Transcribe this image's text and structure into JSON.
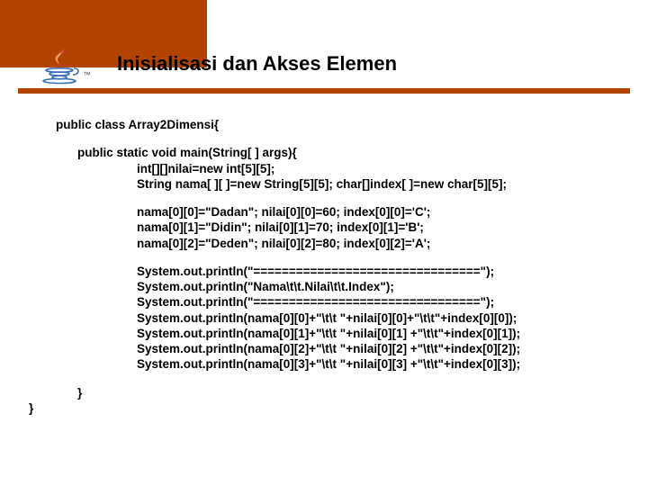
{
  "header": {
    "title": "Inisialisasi dan Akses Elemen",
    "logo_text": "Java"
  },
  "code": {
    "l1": "public class Array2Dimensi{",
    "l2": "public static void main(String[ ] args){",
    "l3": "int[][]nilai=new int[5][5];",
    "l4": "String nama[ ][ ]=new String[5][5];       char[]index[ ]=new char[5][5];",
    "l5": "nama[0][0]=\"Dadan\";   nilai[0][0]=60;    index[0][0]='C';",
    "l6": "nama[0][1]=\"Didin\";    nilai[0][1]=70;    index[0][1]='B';",
    "l7": "nama[0][2]=\"Deden\";   nilai[0][2]=80;    index[0][2]='A';",
    "l8": "System.out.println(\"================================\");",
    "l9": "System.out.println(\"Nama\\t\\t.Nilai\\t\\t.Index\");",
    "l10": "System.out.println(\"================================\");",
    "l11": "System.out.println(nama[0][0]+\"\\t\\t \"+nilai[0][0]+\"\\t\\t\"+index[0][0]);",
    "l12": "System.out.println(nama[0][1]+\"\\t\\t \"+nilai[0][1] +\"\\t\\t\"+index[0][1]);",
    "l13": "System.out.println(nama[0][2]+\"\\t\\t \"+nilai[0][2] +\"\\t\\t\"+index[0][2]);",
    "l14": "System.out.println(nama[0][3]+\"\\t\\t \"+nilai[0][3] +\"\\t\\t\"+index[0][3]);",
    "l15": "}",
    "l16": "}"
  }
}
